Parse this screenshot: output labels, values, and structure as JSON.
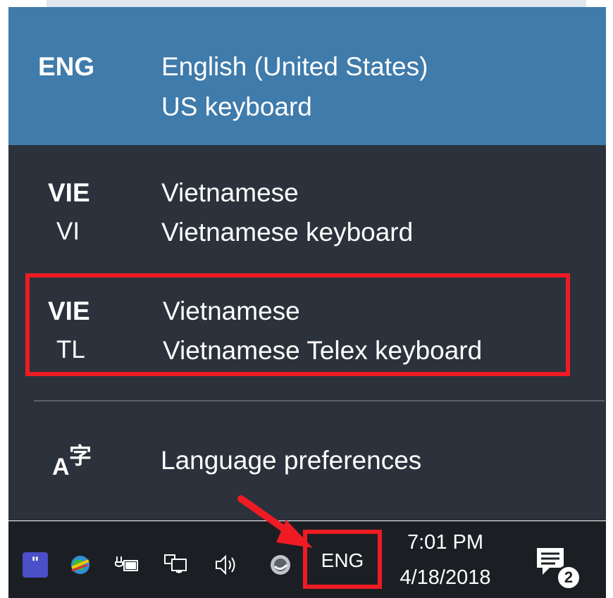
{
  "language_flyout": {
    "items": [
      {
        "code": "ENG",
        "subcode": "",
        "language": "English (United States)",
        "keyboard": "US keyboard",
        "selected": true
      },
      {
        "code": "VIE",
        "subcode": "VI",
        "language": "Vietnamese",
        "keyboard": "Vietnamese keyboard",
        "selected": false
      },
      {
        "code": "VIE",
        "subcode": "TL",
        "language": "Vietnamese",
        "keyboard": "Vietnamese Telex keyboard",
        "selected": false
      }
    ],
    "preferences_label": "Language preferences",
    "preferences_icon_glyphs": {
      "latin": "A",
      "cjk": "字"
    }
  },
  "taskbar": {
    "app_icon_glyph": "\"",
    "input_indicator": "ENG",
    "clock": {
      "time": "7:01 PM",
      "date": "4/18/2018"
    },
    "notification_count": "2"
  },
  "colors": {
    "flyout_bg": "#2b323b",
    "selected_bg": "#3f7bab",
    "taskbar_bg": "#1b1f24",
    "annotation_red": "#ee1b24"
  },
  "icons": [
    "app-icon",
    "globe-icon",
    "power-icon",
    "network-icon",
    "volume-icon",
    "misc-icon",
    "notification-icon"
  ]
}
